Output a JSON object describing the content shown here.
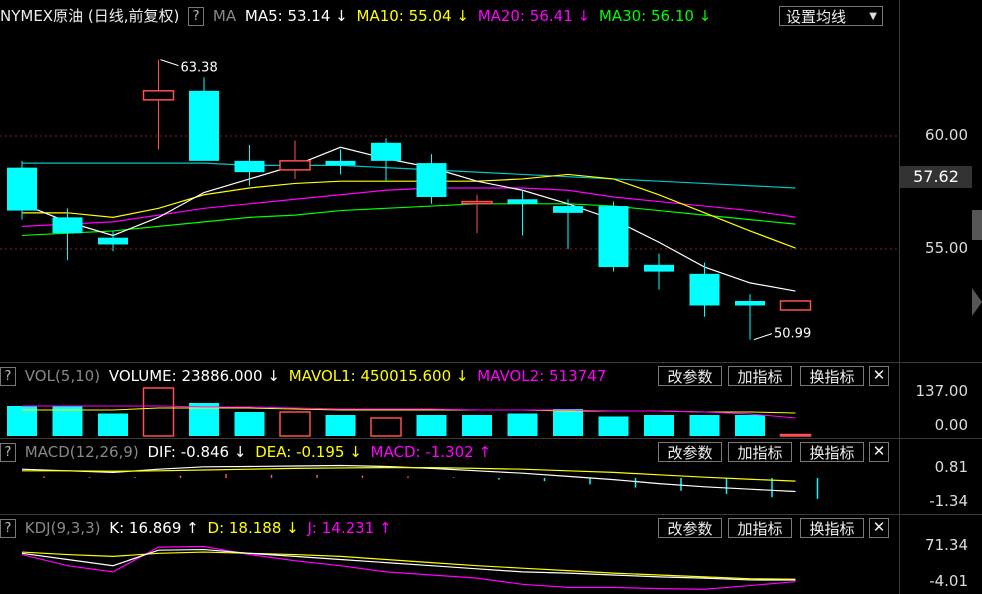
{
  "main": {
    "title": "NYMEX原油 (日线,前复权)",
    "help": "?",
    "indicator": "MA",
    "ma5": "MA5: 53.14 ↓",
    "ma10": "MA10: 55.04 ↓",
    "ma20": "MA20: 56.41 ↓",
    "ma30": "MA30: 56.10 ↓",
    "set_ma_label": "设置均线",
    "price_axis": [
      "60.00",
      "55.00"
    ],
    "current_price": "57.62",
    "high_label": "63.38",
    "low_label": "50.99"
  },
  "vol": {
    "help": "?",
    "name": "VOL(5,10)",
    "volume": "VOLUME: 23886.000 ↓",
    "mavol1": "MAVOL1: 450015.600 ↓",
    "mavol2": "MAVOL2: 513747",
    "axis": [
      "137.00",
      "0.00"
    ]
  },
  "macd": {
    "help": "?",
    "name": "MACD(12,26,9)",
    "dif": "DIF: -0.846 ↓",
    "dea": "DEA: -0.195 ↓",
    "macd": "MACD: -1.302 ↑",
    "axis": [
      "0.81",
      "-1.34"
    ]
  },
  "kdj": {
    "help": "?",
    "name": "KDJ(9,3,3)",
    "k": "K: 16.869 ↑",
    "d": "D: 18.188 ↓",
    "j": "J: 14.231 ↑",
    "axis": [
      "71.34",
      "-4.01"
    ]
  },
  "buttons": {
    "params": "改参数",
    "add": "加指标",
    "swap": "换指标",
    "close": "✕"
  },
  "colors": {
    "up": "#ff5050",
    "down": "#00ffff",
    "ma5": "#ffffff",
    "ma10": "#ffff00",
    "ma20": "#ff00ff",
    "ma30": "#00ff00",
    "ma_extra": "#00c8c8"
  },
  "chart_data": {
    "type": "candlestick",
    "ylim": [
      49,
      66
    ],
    "ticks": [
      60,
      55
    ],
    "candles": [
      {
        "o": 58.6,
        "h": 58.9,
        "c": 56.7,
        "l": 56.3
      },
      {
        "o": 56.4,
        "h": 56.8,
        "c": 55.7,
        "l": 54.5
      },
      {
        "o": 55.5,
        "h": 55.8,
        "c": 55.2,
        "l": 54.9
      },
      {
        "o": 61.6,
        "h": 63.38,
        "c": 62.0,
        "l": 59.4
      },
      {
        "o": 62.0,
        "h": 62.6,
        "c": 58.9,
        "l": 59.2
      },
      {
        "o": 58.9,
        "h": 59.6,
        "c": 58.4,
        "l": 57.8
      },
      {
        "o": 58.5,
        "h": 59.8,
        "c": 58.9,
        "l": 58.1
      },
      {
        "o": 58.9,
        "h": 59.4,
        "c": 58.7,
        "l": 58.3
      },
      {
        "o": 59.7,
        "h": 59.9,
        "c": 58.9,
        "l": 58.0
      },
      {
        "o": 58.8,
        "h": 59.2,
        "c": 57.3,
        "l": 57.0
      },
      {
        "o": 57.1,
        "h": 57.4,
        "c": 57.1,
        "l": 55.7
      },
      {
        "o": 57.2,
        "h": 57.6,
        "c": 57.0,
        "l": 55.6
      },
      {
        "o": 56.9,
        "h": 57.2,
        "c": 56.6,
        "l": 55.0
      },
      {
        "o": 56.9,
        "h": 57.1,
        "c": 54.2,
        "l": 54.0
      },
      {
        "o": 54.3,
        "h": 54.8,
        "c": 54.0,
        "l": 53.2
      },
      {
        "o": 53.9,
        "h": 54.4,
        "c": 52.5,
        "l": 52.0
      },
      {
        "o": 52.7,
        "h": 53.0,
        "c": 52.5,
        "l": 50.99
      },
      {
        "o": 52.3,
        "h": 52.7,
        "c": 52.7,
        "l": 52.3
      }
    ],
    "ma5": [
      57.0,
      56.2,
      55.6,
      56.4,
      57.5,
      58.1,
      58.7,
      59.5,
      59.0,
      58.6,
      58.0,
      57.6,
      57.0,
      56.3,
      55.3,
      54.2,
      53.5,
      53.14
    ],
    "ma10": [
      56.6,
      56.6,
      56.4,
      56.8,
      57.4,
      57.7,
      57.9,
      58.0,
      58.0,
      58.0,
      58.0,
      58.1,
      58.3,
      58.1,
      57.4,
      56.6,
      55.8,
      55.04
    ],
    "ma20": [
      56.0,
      56.1,
      56.2,
      56.5,
      56.8,
      57.0,
      57.2,
      57.4,
      57.6,
      57.7,
      57.7,
      57.7,
      57.6,
      57.3,
      57.1,
      56.9,
      56.7,
      56.41
    ],
    "ma30": [
      55.6,
      55.7,
      55.8,
      56.0,
      56.2,
      56.4,
      56.5,
      56.7,
      56.8,
      56.9,
      57.0,
      57.0,
      57.0,
      56.9,
      56.7,
      56.5,
      56.3,
      56.1
    ],
    "ma_extra": [
      58.8,
      58.8,
      58.8,
      58.8,
      58.8,
      58.7,
      58.7,
      58.7,
      58.6,
      58.5,
      58.4,
      58.3,
      58.2,
      58.1,
      58.0,
      57.9,
      57.8,
      57.7
    ],
    "volume": [
      {
        "v": 1.0,
        "up": false
      },
      {
        "v": 1.0,
        "up": false
      },
      {
        "v": 0.75,
        "up": false
      },
      {
        "v": 1.6,
        "up": true
      },
      {
        "v": 1.1,
        "up": false
      },
      {
        "v": 0.8,
        "up": false
      },
      {
        "v": 0.8,
        "up": true
      },
      {
        "v": 0.7,
        "up": false
      },
      {
        "v": 0.6,
        "up": true
      },
      {
        "v": 0.7,
        "up": false
      },
      {
        "v": 0.7,
        "up": false
      },
      {
        "v": 0.75,
        "up": false
      },
      {
        "v": 0.9,
        "up": false
      },
      {
        "v": 0.65,
        "up": false
      },
      {
        "v": 0.7,
        "up": false
      },
      {
        "v": 0.7,
        "up": false
      },
      {
        "v": 0.7,
        "up": false
      },
      {
        "v": 0.05,
        "up": true
      }
    ],
    "macd_hist": [
      0.1,
      0.05,
      0.05,
      0.15,
      0.25,
      0.2,
      0.2,
      0.15,
      0.1,
      0.05,
      -0.1,
      -0.2,
      -0.4,
      -0.6,
      -0.8,
      -1.0,
      -1.2,
      -1.302
    ],
    "macd_dif": [
      0.55,
      0.45,
      0.35,
      0.55,
      0.7,
      0.72,
      0.75,
      0.78,
      0.72,
      0.6,
      0.45,
      0.3,
      0.1,
      -0.1,
      -0.35,
      -0.55,
      -0.7,
      -0.846
    ],
    "macd_dea": [
      0.45,
      0.45,
      0.42,
      0.45,
      0.5,
      0.55,
      0.6,
      0.63,
      0.65,
      0.65,
      0.6,
      0.55,
      0.45,
      0.35,
      0.2,
      0.05,
      -0.08,
      -0.195
    ],
    "kdj_k": [
      60,
      50,
      40,
      65,
      66,
      60,
      55,
      50,
      45,
      40,
      35,
      30,
      28,
      25,
      22,
      20,
      17,
      16.869
    ],
    "kdj_d": [
      62,
      58,
      55,
      60,
      62,
      60,
      58,
      55,
      50,
      45,
      40,
      36,
      32,
      28,
      25,
      22,
      19,
      18.188
    ],
    "kdj_j": [
      58,
      40,
      30,
      70,
      71,
      58,
      48,
      40,
      30,
      25,
      20,
      10,
      5,
      5,
      3,
      2,
      8,
      14.231
    ]
  }
}
